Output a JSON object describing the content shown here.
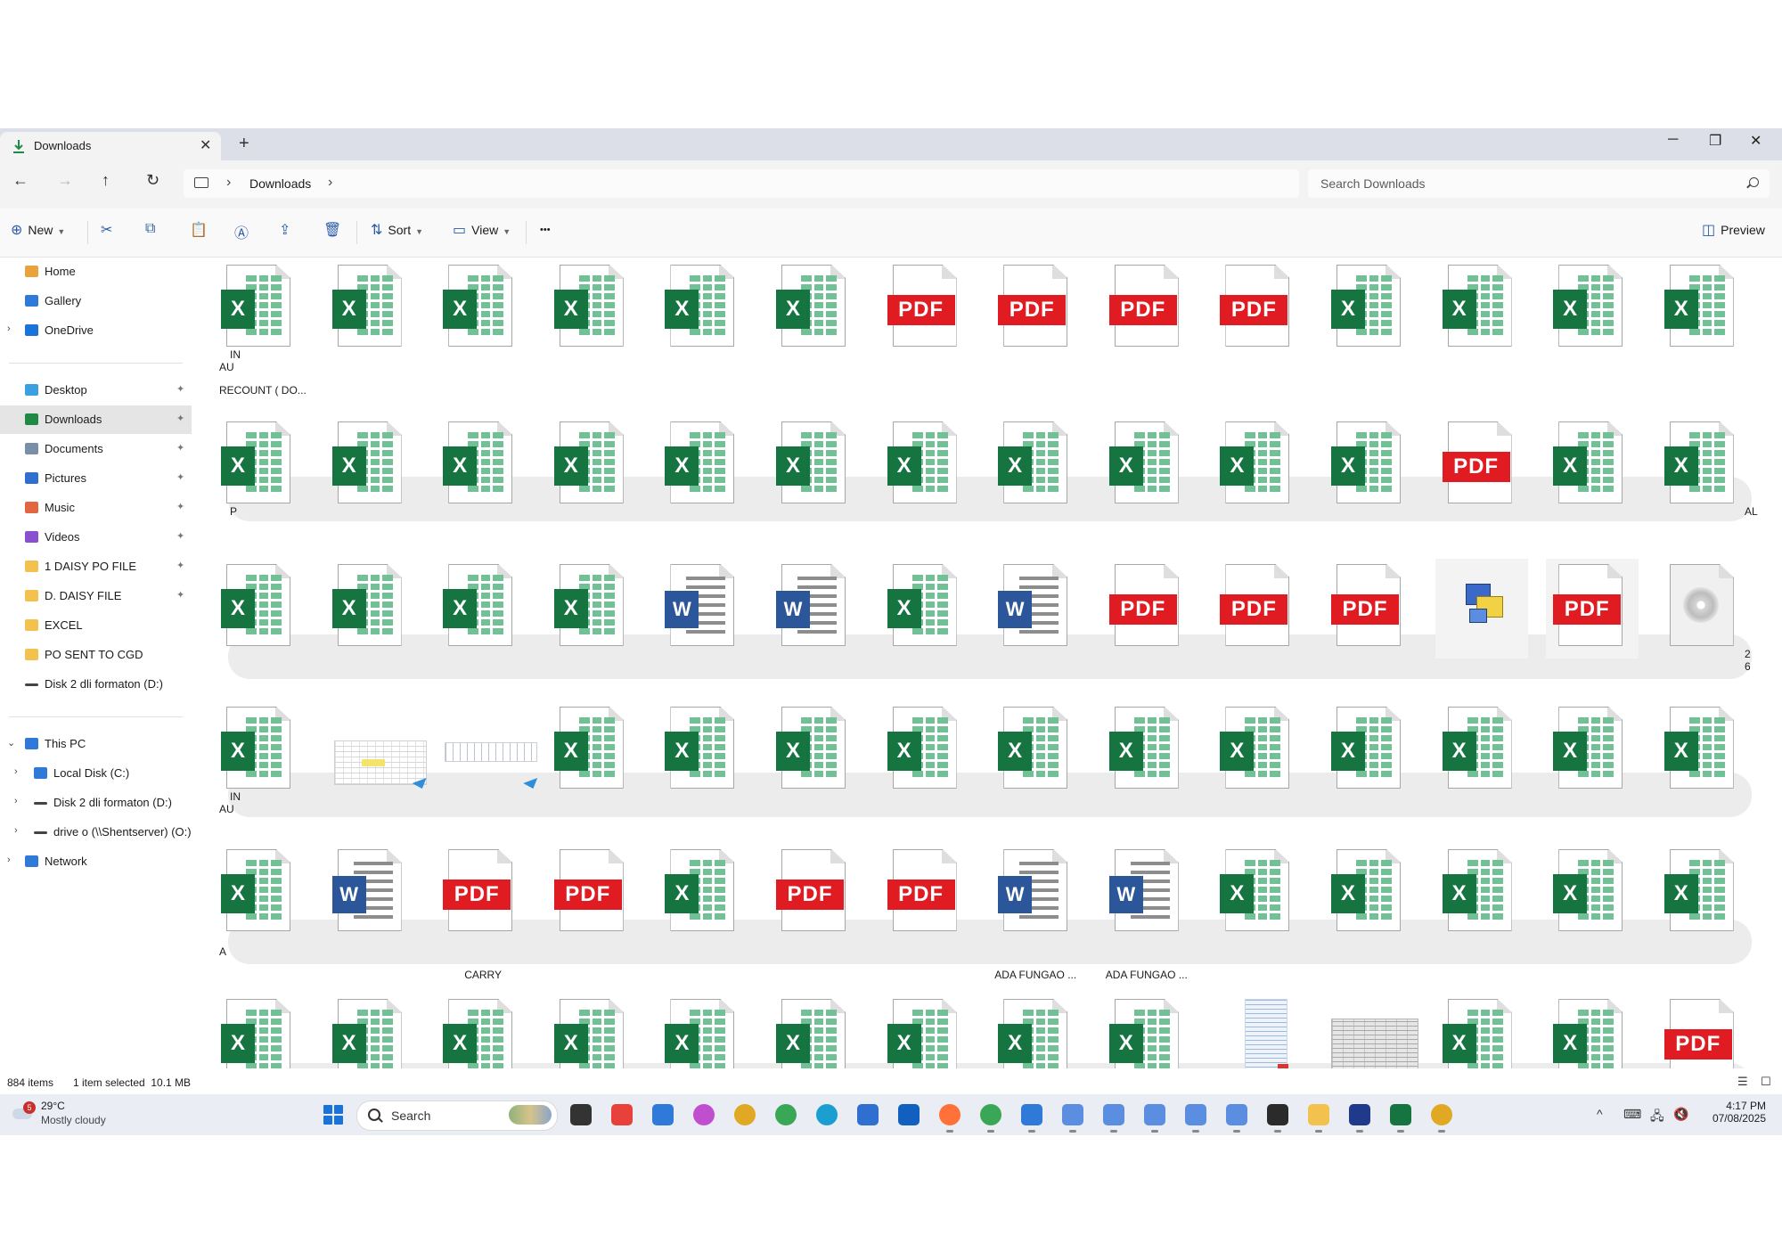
{
  "window": {
    "tab_title": "Downloads",
    "tab_close": "✕",
    "new_tab": "+",
    "minimize": "─",
    "maximize": "❐",
    "close": "✕"
  },
  "nav": {
    "back": "←",
    "forward": "→",
    "up": "↑",
    "refresh": "↻",
    "breadcrumb_sep": "›",
    "breadcrumb": "Downloads",
    "search_placeholder": "Search Downloads"
  },
  "toolbar": {
    "new_label": "New",
    "sort_label": "Sort",
    "view_label": "View",
    "more": "•••",
    "preview_label": "Preview",
    "icons": [
      "cut-icon",
      "copy-icon",
      "paste-icon",
      "rename-icon",
      "share-icon",
      "delete-icon"
    ]
  },
  "sidebar": {
    "items": [
      {
        "label": "Home",
        "icon": "home-icon",
        "color": "#e8a33d"
      },
      {
        "label": "Gallery",
        "icon": "gallery-icon",
        "color": "#2f7ad8"
      },
      {
        "label": "OneDrive",
        "icon": "cloud-icon",
        "color": "#1a73d9"
      },
      {
        "label": "Desktop",
        "icon": "desktop-icon",
        "color": "#3aa0e0"
      },
      {
        "label": "Downloads",
        "icon": "download-icon",
        "color": "#1f8a45"
      },
      {
        "label": "Documents",
        "icon": "documents-icon",
        "color": "#7a8ea8"
      },
      {
        "label": "Pictures",
        "icon": "pictures-icon",
        "color": "#2f6fd0"
      },
      {
        "label": "Music",
        "icon": "music-icon",
        "color": "#e2663f"
      },
      {
        "label": "Videos",
        "icon": "videos-icon",
        "color": "#8a4fd0"
      },
      {
        "label": "1 DAISY PO FILE",
        "icon": "folder-icon",
        "color": "#f2c14e"
      },
      {
        "label": "D. DAISY FILE",
        "icon": "folder-icon",
        "color": "#f2c14e"
      },
      {
        "label": "EXCEL",
        "icon": "folder-icon",
        "color": "#f2c14e"
      },
      {
        "label": "PO SENT TO CGD",
        "icon": "folder-icon",
        "color": "#f2c14e"
      },
      {
        "label": "Disk 2 dli formaton (D:)",
        "icon": "drive-icon",
        "color": "#444444"
      },
      {
        "label": "This PC",
        "icon": "pc-icon",
        "color": "#2f7ad8"
      },
      {
        "label": "Local Disk (C:)",
        "icon": "disk-icon",
        "color": "#2f7ad8"
      },
      {
        "label": "Disk 2 dli formaton (D:)",
        "icon": "drive-icon",
        "color": "#444444"
      },
      {
        "label": "drive o (\\\\Shentserver) (O:)",
        "icon": "network-drive-icon",
        "color": "#444444"
      },
      {
        "label": "Network",
        "icon": "network-icon",
        "color": "#2f7ad8"
      }
    ],
    "chevron_open": "⌄",
    "chevron_closed": "›",
    "pin": "📌"
  },
  "files": {
    "rows": [
      [
        "xlsx",
        "xlsx",
        "xlsx",
        "xlsx",
        "xlsx",
        "xlsx",
        "pdf",
        "pdf",
        "pdf",
        "pdf",
        "xlsx",
        "xlsx",
        "xlsx",
        "xlsx"
      ],
      [
        "xlsx",
        "xlsx",
        "xlsx",
        "xlsx",
        "xlsx",
        "xlsx",
        "xlsx",
        "xlsx",
        "xlsx",
        "xlsx",
        "xlsx",
        "pdf",
        "xlsx",
        "xlsx"
      ],
      [
        "xlsx",
        "xlsx",
        "xlsx",
        "xlsx",
        "docx",
        "docx",
        "xlsx",
        "docx",
        "pdf",
        "pdf",
        "pdf",
        "exe",
        "pdf",
        "iso"
      ],
      [
        "xlsx",
        "thumb",
        "thumb2",
        "xlsx",
        "xlsx",
        "xlsx",
        "xlsx",
        "xlsx",
        "xlsx",
        "xlsx",
        "xlsx",
        "xlsx",
        "xlsx",
        "xlsx"
      ],
      [
        "xlsx",
        "docx",
        "pdf",
        "pdf",
        "xlsx",
        "pdf",
        "pdf",
        "docx",
        "docx",
        "xlsx",
        "xlsx",
        "xlsx",
        "xlsx",
        "xlsx"
      ],
      [
        "xlsx",
        "xlsx",
        "xlsx",
        "xlsx",
        "xlsx",
        "xlsx",
        "xlsx",
        "xlsx",
        "xlsx",
        "list",
        "scan",
        "xlsx",
        "xlsx",
        "pdf"
      ]
    ],
    "badges": {
      "xlsx": "X",
      "docx": "W",
      "pdf": "PDF"
    },
    "name_fragments": [
      {
        "text": "IN",
        "row": 0,
        "line": 1
      },
      {
        "text": "AU",
        "row": 0,
        "line": 2
      },
      {
        "text": "RECOUNT ( DO...",
        "row": 0,
        "line": 3
      },
      {
        "text": "P",
        "row": 1,
        "line": 1
      },
      {
        "text": "AL",
        "row": 1,
        "line": 1,
        "right": true
      },
      {
        "text": "2",
        "row": 2,
        "line": 1,
        "right": true
      },
      {
        "text": "6",
        "row": 2,
        "line": 2,
        "right": true
      },
      {
        "text": "IN",
        "row": 3,
        "line": 1
      },
      {
        "text": "AU",
        "row": 3,
        "line": 2
      },
      {
        "text": "A",
        "row": 4,
        "line": 2
      },
      {
        "text": "CARRY",
        "row": 4,
        "line": 3,
        "col": 2
      },
      {
        "text": "ADA FUNGAO ...",
        "row": 4,
        "line": 3,
        "col": 7
      },
      {
        "text": "ADA FUNGAO ...",
        "row": 4,
        "line": 3,
        "col": 8
      }
    ]
  },
  "status": {
    "count": "884 items",
    "selection": "1 item selected  10.1 MB",
    "details_view": "☰",
    "tiles_view": "☐"
  },
  "taskbar": {
    "weather_badge": "5",
    "temperature": "29°C",
    "condition": "Mostly cloudy",
    "search_label": "Search",
    "apps": [
      {
        "name": "task-view-icon",
        "color": "#333333"
      },
      {
        "name": "anydesk-icon",
        "color": "#e8403a"
      },
      {
        "name": "widgets-icon",
        "color": "#2f7ad8"
      },
      {
        "name": "copilot-icon",
        "color": "#c04fd0"
      },
      {
        "name": "chrome-icon",
        "color": "#e0a823"
      },
      {
        "name": "chrome-icon",
        "color": "#3aa757"
      },
      {
        "name": "edge-icon",
        "color": "#1a9fd0"
      },
      {
        "name": "store-icon",
        "color": "#2f6fd0"
      },
      {
        "name": "outlook-icon",
        "color": "#1160c0"
      },
      {
        "name": "firefox-icon",
        "color": "#ff7139"
      },
      {
        "name": "chrome-profile-icon",
        "color": "#3aa757"
      },
      {
        "name": "app-icon",
        "color": "#2f7ad8"
      },
      {
        "name": "remote-desktop-icon",
        "color": "#5b8de0"
      },
      {
        "name": "remote-desktop-icon",
        "color": "#5b8de0"
      },
      {
        "name": "remote-desktop-icon",
        "color": "#5b8de0"
      },
      {
        "name": "remote-desktop-icon",
        "color": "#5b8de0"
      },
      {
        "name": "remote-desktop-icon",
        "color": "#5b8de0"
      },
      {
        "name": "sticky-notes-icon",
        "color": "#2b2b2b"
      },
      {
        "name": "file-explorer-icon",
        "color": "#f2c14e"
      },
      {
        "name": "app-icon",
        "color": "#1f3a8a"
      },
      {
        "name": "excel-icon",
        "color": "#167441"
      },
      {
        "name": "chrome-profile-icon",
        "color": "#e0a823"
      }
    ],
    "tray_chevron": "^",
    "keyboard": "⌨",
    "network": "🖧",
    "volume": "🔇",
    "time": "4:17 PM",
    "date": "07/08/2025"
  }
}
